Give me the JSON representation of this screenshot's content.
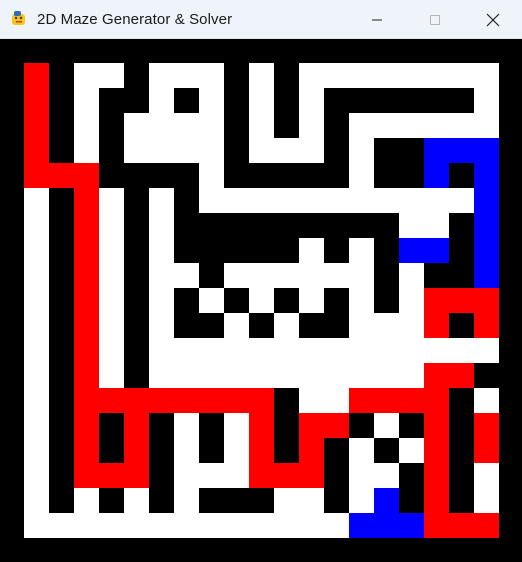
{
  "window": {
    "title": "2D Maze Generator & Solver",
    "app_icon": "python-snake-icon",
    "controls": [
      "minimize-icon",
      "maximize-icon",
      "close-icon"
    ]
  },
  "maze": {
    "colors": {
      "wall": "#000000",
      "path": "#ffffff",
      "solution": "#ff0000",
      "explored": "#0000ff"
    }
  }
}
